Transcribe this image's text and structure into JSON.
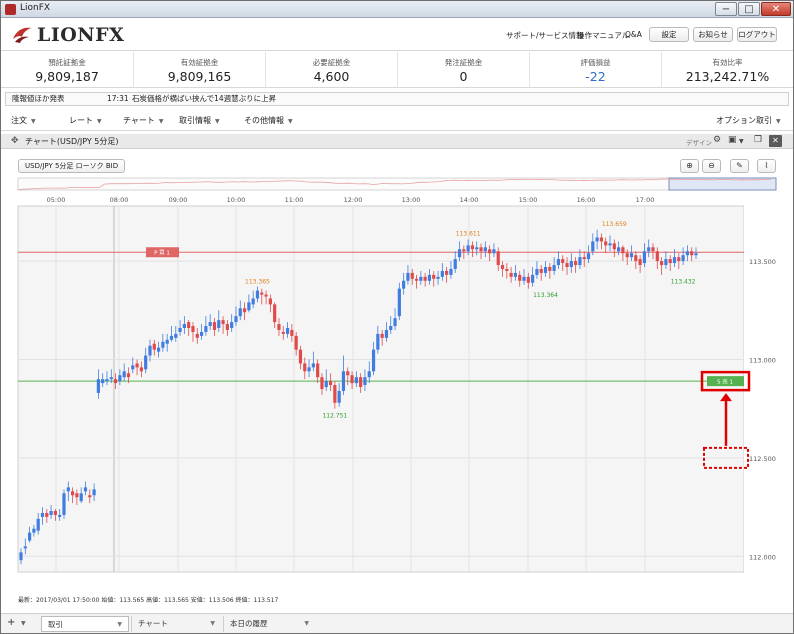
{
  "window": {
    "title": "LionFX",
    "minimize": "−",
    "maximize": "□",
    "close": "✕"
  },
  "header": {
    "logo_text": "LIONFX",
    "links": [
      "サポート/サービス情報",
      "操作マニュアル",
      "Q&A"
    ],
    "buttons": [
      "設定",
      "お知らせ",
      "ログアウト"
    ]
  },
  "summary": [
    {
      "label": "預託証拠金",
      "value": "9,809,187"
    },
    {
      "label": "有効証拠金",
      "value": "9,809,165"
    },
    {
      "label": "必要証拠金",
      "value": "4,600"
    },
    {
      "label": "発注証拠金",
      "value": "0"
    },
    {
      "label": "評価損益",
      "value": "-22"
    },
    {
      "label": "有効比率",
      "value": "213,242.71%"
    }
  ],
  "news": {
    "source": "隆報値ほか発表",
    "time": "17:31",
    "headline": "石炭価格が横ばい挟んで14週慧ぶりに上昇"
  },
  "menu": {
    "items": [
      "注文",
      "レート",
      "チャート",
      "取引情報",
      "その他情報"
    ],
    "options": "オプション取引"
  },
  "panel": {
    "title": "チャート(USD/JPY 5分足)",
    "design_label": "デザイン",
    "close": "✕"
  },
  "chart_toolbar": {
    "symbol_button": "USD/JPY 5分足 ローソク BID",
    "zoom_in": "⊕",
    "zoom_out": "⊖",
    "pen": "✎",
    "tool": "⌇"
  },
  "chart_data": {
    "type": "candlestick",
    "x_ticks": [
      "05:00",
      "08:00",
      "09:00",
      "10:00",
      "11:00",
      "12:00",
      "13:00",
      "14:00",
      "15:00",
      "16:00",
      "17:00"
    ],
    "y_ticks": [
      "113.500",
      "113.000",
      "112.500",
      "112.000"
    ],
    "ylim": [
      111.92,
      113.78
    ],
    "annotations": [
      {
        "text": "113.365",
        "value": 113.365,
        "slot": 55,
        "kind": "high"
      },
      {
        "text": "112.751",
        "value": 112.751,
        "slot": 73,
        "kind": "low"
      },
      {
        "text": "113.611",
        "value": 113.611,
        "slot": 104,
        "kind": "high"
      },
      {
        "text": "113.364",
        "value": 113.364,
        "slot": 122,
        "kind": "low"
      },
      {
        "text": "113.659",
        "value": 113.659,
        "slot": 138,
        "kind": "high"
      },
      {
        "text": "113.432",
        "value": 113.432,
        "slot": 154,
        "kind": "low"
      }
    ],
    "lines": [
      {
        "label": "P 買 1",
        "value": 113.545,
        "color": "#e06666"
      },
      {
        "label": "S 売 1",
        "value": 112.89,
        "color": "#55b34f"
      }
    ],
    "candles": [
      [
        112.02,
        112.04,
        111.96,
        111.98
      ],
      [
        112.05,
        112.09,
        112.01,
        112.04
      ],
      [
        112.12,
        112.15,
        112.07,
        112.08
      ],
      [
        112.14,
        112.16,
        112.1,
        112.12
      ],
      [
        112.19,
        112.22,
        112.11,
        112.13
      ],
      [
        112.22,
        112.25,
        112.16,
        112.2
      ],
      [
        112.2,
        112.24,
        112.17,
        112.22
      ],
      [
        112.23,
        112.26,
        112.19,
        112.21
      ],
      [
        112.21,
        112.24,
        112.18,
        112.23
      ],
      [
        112.21,
        112.24,
        112.18,
        112.2
      ],
      [
        112.32,
        112.34,
        112.19,
        112.21
      ],
      [
        112.35,
        112.38,
        112.28,
        112.33
      ],
      [
        112.31,
        112.35,
        112.27,
        112.33
      ],
      [
        112.3,
        112.34,
        112.26,
        112.32
      ],
      [
        112.32,
        112.35,
        112.27,
        112.28
      ],
      [
        112.35,
        112.38,
        112.31,
        112.33
      ],
      [
        112.3,
        112.34,
        112.27,
        112.31
      ],
      [
        112.34,
        112.37,
        112.28,
        112.31
      ],
      [
        112.9,
        112.95,
        112.8,
        112.83
      ],
      [
        112.9,
        112.93,
        112.86,
        112.88
      ],
      [
        112.9,
        112.94,
        112.87,
        112.89
      ],
      [
        112.91,
        112.95,
        112.88,
        112.9
      ],
      [
        112.88,
        112.93,
        112.85,
        112.9
      ],
      [
        112.92,
        112.95,
        112.87,
        112.89
      ],
      [
        112.94,
        112.98,
        112.89,
        112.91
      ],
      [
        112.91,
        112.96,
        112.88,
        112.93
      ],
      [
        112.97,
        113.01,
        112.93,
        112.95
      ],
      [
        112.96,
        113.0,
        112.92,
        112.98
      ],
      [
        112.94,
        112.99,
        112.91,
        112.96
      ],
      [
        113.02,
        113.06,
        112.93,
        112.95
      ],
      [
        113.07,
        113.1,
        112.99,
        113.02
      ],
      [
        113.05,
        113.1,
        113.02,
        113.08
      ],
      [
        113.06,
        113.09,
        113.01,
        113.04
      ],
      [
        113.09,
        113.13,
        113.04,
        113.06
      ],
      [
        113.1,
        113.13,
        113.04,
        113.08
      ],
      [
        113.12,
        113.17,
        113.09,
        113.1
      ],
      [
        113.13,
        113.17,
        113.09,
        113.11
      ],
      [
        113.16,
        113.2,
        113.12,
        113.14
      ],
      [
        113.18,
        113.22,
        113.13,
        113.16
      ],
      [
        113.16,
        113.2,
        113.12,
        113.19
      ],
      [
        113.14,
        113.19,
        113.09,
        113.17
      ],
      [
        113.11,
        113.16,
        113.08,
        113.13
      ],
      [
        113.14,
        113.18,
        113.1,
        113.12
      ],
      [
        113.17,
        113.22,
        113.12,
        113.14
      ],
      [
        113.19,
        113.23,
        113.15,
        113.17
      ],
      [
        113.15,
        113.21,
        113.12,
        113.19
      ],
      [
        113.2,
        113.25,
        113.14,
        113.16
      ],
      [
        113.18,
        113.22,
        113.13,
        113.2
      ],
      [
        113.15,
        113.2,
        113.12,
        113.18
      ],
      [
        113.19,
        113.23,
        113.14,
        113.16
      ],
      [
        113.22,
        113.27,
        113.17,
        113.19
      ],
      [
        113.26,
        113.3,
        113.2,
        113.22
      ],
      [
        113.24,
        113.29,
        113.2,
        113.26
      ],
      [
        113.29,
        113.33,
        113.24,
        113.25
      ],
      [
        113.31,
        113.35,
        113.26,
        113.28
      ],
      [
        113.35,
        113.37,
        113.29,
        113.31
      ],
      [
        113.33,
        113.36,
        113.28,
        113.34
      ],
      [
        113.32,
        113.35,
        113.28,
        113.33
      ],
      [
        113.28,
        113.33,
        113.24,
        113.31
      ],
      [
        113.19,
        113.29,
        113.16,
        113.28
      ],
      [
        113.15,
        113.21,
        113.12,
        113.18
      ],
      [
        113.13,
        113.17,
        113.1,
        113.14
      ],
      [
        113.16,
        113.19,
        113.11,
        113.13
      ],
      [
        113.12,
        113.18,
        113.09,
        113.15
      ],
      [
        113.05,
        113.14,
        113.02,
        113.12
      ],
      [
        112.98,
        113.07,
        112.95,
        113.05
      ],
      [
        112.94,
        113.01,
        112.9,
        112.98
      ],
      [
        112.96,
        113.0,
        112.91,
        112.94
      ],
      [
        112.98,
        113.04,
        112.94,
        112.96
      ],
      [
        112.91,
        113.0,
        112.88,
        112.98
      ],
      [
        112.85,
        112.93,
        112.82,
        112.91
      ],
      [
        112.89,
        112.95,
        112.84,
        112.86
      ],
      [
        112.87,
        112.93,
        112.84,
        112.89
      ],
      [
        112.78,
        112.89,
        112.75,
        112.87
      ],
      [
        112.84,
        112.88,
        112.76,
        112.78
      ],
      [
        112.94,
        113.02,
        112.82,
        112.84
      ],
      [
        112.92,
        112.96,
        112.87,
        112.94
      ],
      [
        112.88,
        112.94,
        112.85,
        112.92
      ],
      [
        112.91,
        112.94,
        112.86,
        112.88
      ],
      [
        112.86,
        112.93,
        112.83,
        112.91
      ],
      [
        112.91,
        112.95,
        112.84,
        112.87
      ],
      [
        112.94,
        112.99,
        112.88,
        112.91
      ],
      [
        113.05,
        113.09,
        112.92,
        112.94
      ],
      [
        113.13,
        113.17,
        113.03,
        113.05
      ],
      [
        113.11,
        113.15,
        113.07,
        113.13
      ],
      [
        113.15,
        113.19,
        113.09,
        113.11
      ],
      [
        113.17,
        113.22,
        113.13,
        113.15
      ],
      [
        113.21,
        113.26,
        113.15,
        113.17
      ],
      [
        113.36,
        113.39,
        113.2,
        113.22
      ],
      [
        113.4,
        113.44,
        113.33,
        113.36
      ],
      [
        113.44,
        113.48,
        113.38,
        113.4
      ],
      [
        113.41,
        113.46,
        113.38,
        113.44
      ],
      [
        113.4,
        113.43,
        113.36,
        113.41
      ],
      [
        113.42,
        113.45,
        113.38,
        113.4
      ],
      [
        113.4,
        113.44,
        113.37,
        113.42
      ],
      [
        113.43,
        113.46,
        113.38,
        113.4
      ],
      [
        113.41,
        113.45,
        113.37,
        113.43
      ],
      [
        113.42,
        113.45,
        113.38,
        113.41
      ],
      [
        113.45,
        113.49,
        113.4,
        113.42
      ],
      [
        113.43,
        113.47,
        113.39,
        113.45
      ],
      [
        113.46,
        113.5,
        113.41,
        113.43
      ],
      [
        113.51,
        113.55,
        113.44,
        113.46
      ],
      [
        113.56,
        113.6,
        113.5,
        113.52
      ],
      [
        113.55,
        113.58,
        113.51,
        113.56
      ],
      [
        113.58,
        113.61,
        113.53,
        113.55
      ],
      [
        113.56,
        113.6,
        113.52,
        113.58
      ],
      [
        113.57,
        113.6,
        113.53,
        113.56
      ],
      [
        113.55,
        113.59,
        113.51,
        113.57
      ],
      [
        113.57,
        113.6,
        113.52,
        113.55
      ],
      [
        113.54,
        113.58,
        113.5,
        113.56
      ],
      [
        113.56,
        113.59,
        113.52,
        113.54
      ],
      [
        113.48,
        113.57,
        113.45,
        113.55
      ],
      [
        113.46,
        113.5,
        113.42,
        113.48
      ],
      [
        113.45,
        113.49,
        113.41,
        113.46
      ],
      [
        113.42,
        113.47,
        113.39,
        113.44
      ],
      [
        113.44,
        113.48,
        113.4,
        113.42
      ],
      [
        113.4,
        113.45,
        113.37,
        113.43
      ],
      [
        113.42,
        113.46,
        113.38,
        113.4
      ],
      [
        113.39,
        113.44,
        113.36,
        113.42
      ],
      [
        113.43,
        113.47,
        113.37,
        113.39
      ],
      [
        113.46,
        113.5,
        113.41,
        113.43
      ],
      [
        113.44,
        113.48,
        113.4,
        113.46
      ],
      [
        113.47,
        113.5,
        113.42,
        113.44
      ],
      [
        113.45,
        113.49,
        113.41,
        113.47
      ],
      [
        113.48,
        113.52,
        113.43,
        113.45
      ],
      [
        113.51,
        113.55,
        113.46,
        113.48
      ],
      [
        113.49,
        113.53,
        113.45,
        113.51
      ],
      [
        113.47,
        113.52,
        113.43,
        113.49
      ],
      [
        113.5,
        113.54,
        113.44,
        113.47
      ],
      [
        113.48,
        113.52,
        113.44,
        113.5
      ],
      [
        113.52,
        113.56,
        113.46,
        113.48
      ],
      [
        113.51,
        113.55,
        113.47,
        113.52
      ],
      [
        113.54,
        113.58,
        113.49,
        113.51
      ],
      [
        113.6,
        113.64,
        113.53,
        113.55
      ],
      [
        113.62,
        113.66,
        113.56,
        113.6
      ],
      [
        113.6,
        113.64,
        113.56,
        113.62
      ],
      [
        113.58,
        113.62,
        113.54,
        113.6
      ],
      [
        113.59,
        113.63,
        113.55,
        113.58
      ],
      [
        113.56,
        113.61,
        113.52,
        113.59
      ],
      [
        113.57,
        113.6,
        113.53,
        113.55
      ],
      [
        113.54,
        113.58,
        113.5,
        113.57
      ],
      [
        113.52,
        113.56,
        113.48,
        113.54
      ],
      [
        113.54,
        113.58,
        113.5,
        113.52
      ],
      [
        113.5,
        113.55,
        113.46,
        113.53
      ],
      [
        113.48,
        113.53,
        113.44,
        113.51
      ],
      [
        113.55,
        113.59,
        113.47,
        113.49
      ],
      [
        113.57,
        113.61,
        113.52,
        113.55
      ],
      [
        113.55,
        113.59,
        113.51,
        113.57
      ],
      [
        113.5,
        113.57,
        113.46,
        113.55
      ],
      [
        113.48,
        113.52,
        113.43,
        113.5
      ],
      [
        113.51,
        113.55,
        113.46,
        113.48
      ],
      [
        113.49,
        113.53,
        113.45,
        113.51
      ],
      [
        113.52,
        113.56,
        113.47,
        113.49
      ],
      [
        113.5,
        113.54,
        113.46,
        113.52
      ],
      [
        113.53,
        113.57,
        113.48,
        113.5
      ],
      [
        113.55,
        113.58,
        113.5,
        113.53
      ],
      [
        113.53,
        113.57,
        113.5,
        113.55
      ],
      [
        113.54,
        113.57,
        113.51,
        113.53
      ]
    ]
  },
  "status_text": "最新：2017/03/01 17:50:00 始値：113.565 高値：113.565 安値：113.506 終値：113.517",
  "bottombar": {
    "add": "+",
    "tabs": [
      "取引",
      "チャート",
      "本日の履歴"
    ]
  },
  "colors": {
    "up": "#e04a4a",
    "down": "#3f7de0",
    "high_label": "#e07d16",
    "low_label": "#2d9e2d",
    "callout": "#e00000"
  }
}
